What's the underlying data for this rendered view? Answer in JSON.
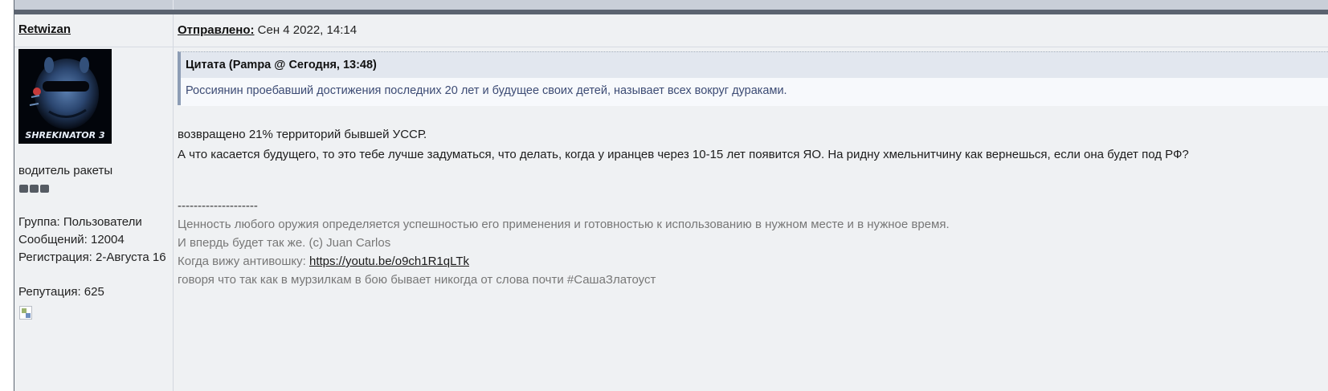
{
  "author": {
    "username": "Retwizan",
    "avatar_caption": "SHREKINATOR 3",
    "title": "водитель ракеты",
    "rank_pips": 3,
    "group": "Группа: Пользователи",
    "messages": "Сообщений: 12004",
    "registration": "Регистрация: 2-Августа 16",
    "reputation": "Репутация: 625"
  },
  "post_header": {
    "posted_label": "Отправлено:",
    "posted_date": "Сен 4 2022, 14:14"
  },
  "quote": {
    "header": "Цитата (Pampa @ Сегодня, 13:48)",
    "text": "Россиянин проебавший достижения последних 20 лет и будущее своих детей, называет всех вокруг дураками."
  },
  "post_body": {
    "line1": "возвращено 21% территорий бывшей УССР.",
    "line2": "А что касается будущего, то это тебе лучше задуматься, что делать, когда у иранцев через 10-15 лет появится ЯО. На ридну хмельнитчину как вернешься, если она будет под РФ?"
  },
  "signature": {
    "separator": "--------------------",
    "line1": "Ценность любого оружия определяется успешностью его применения и готовностью к использованию в нужном месте и в нужное время.",
    "line2": "И впердь будет так же. (c) Juan Carlos",
    "line3_prefix": "Когда вижу антивошку: ",
    "link": "https://youtu.be/o9ch1R1qLTk",
    "line4": "говоря что так как в мурзилкам в бою бывает никогда от слова почти #СашаЗлатоуст"
  },
  "colors": {
    "page_bg": "#eff1f3",
    "top_bar": "#5b6370",
    "quote_header_bg": "#e2e7ef",
    "quote_text": "#3c4b74",
    "signature_text": "#777777"
  }
}
